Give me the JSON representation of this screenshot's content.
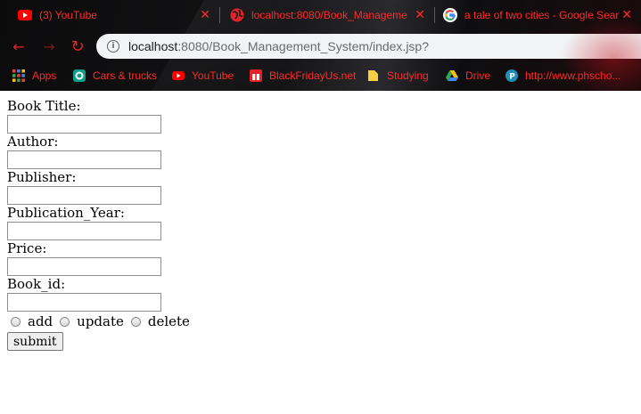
{
  "browser": {
    "tabs": [
      {
        "title": "(3) YouTube",
        "close": "✕"
      },
      {
        "title": "localhost:8080/Book_Manageme",
        "close": "✕"
      },
      {
        "title": "a tale of two cities - Google Sear",
        "close": "✕"
      }
    ],
    "nav": {
      "back": "←",
      "forward": "→",
      "reload": "↻"
    },
    "address": {
      "info": "i",
      "host": "localhost",
      "path": ":8080/Book_Management_System/index.jsp?"
    },
    "bookmarks": [
      "Apps",
      "Cars & trucks",
      "YouTube",
      "BlackFridayUs.net",
      "Studying",
      "Drive",
      "http://www.phscho..."
    ]
  },
  "form": {
    "fields": [
      {
        "label": "Book Title:",
        "value": ""
      },
      {
        "label": "Author:",
        "value": ""
      },
      {
        "label": "Publisher:",
        "value": ""
      },
      {
        "label": "Publication_Year:",
        "value": ""
      },
      {
        "label": "Price:",
        "value": ""
      },
      {
        "label": "Book_id:",
        "value": ""
      }
    ],
    "actions": [
      "add",
      "update",
      "delete"
    ],
    "submit_label": "submit"
  },
  "colors": {
    "accent": "#ff2a2a",
    "chrome_bg": "#0b0b0c",
    "omnibox_bg": "#f1f3f4"
  }
}
